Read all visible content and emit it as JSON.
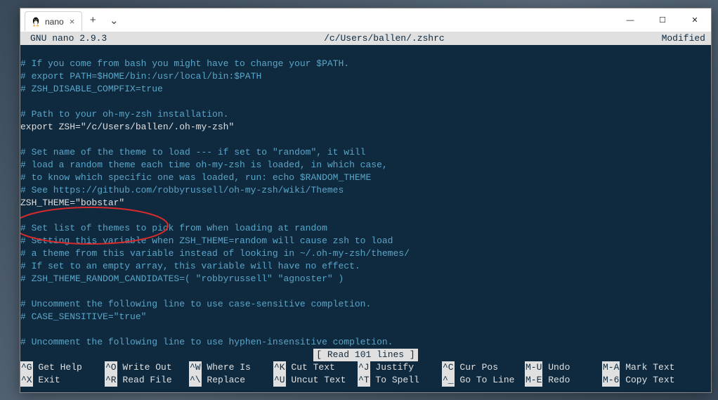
{
  "titlebar": {
    "tab_label": "nano",
    "tab_close": "×",
    "plus": "+",
    "chevron": "⌄"
  },
  "win": {
    "min": "—",
    "max": "☐",
    "close": "✕"
  },
  "nano_header": {
    "left": "GNU nano 2.9.3",
    "center": "/c/Users/ballen/.zshrc",
    "right": "Modified"
  },
  "status": "[ Read 101 lines ]",
  "lines": [
    {
      "cls": "blank",
      "t": ""
    },
    {
      "cls": "comment",
      "t": "# If you come from bash you might have to change your $PATH."
    },
    {
      "cls": "comment",
      "t": "# export PATH=$HOME/bin:/usr/local/bin:$PATH"
    },
    {
      "cls": "comment",
      "t": "# ZSH_DISABLE_COMPFIX=true"
    },
    {
      "cls": "blank",
      "t": ""
    },
    {
      "cls": "comment",
      "t": "# Path to your oh-my-zsh installation."
    },
    {
      "cls": "plain",
      "t": "export ZSH=\"/c/Users/ballen/.oh-my-zsh\""
    },
    {
      "cls": "blank",
      "t": ""
    },
    {
      "cls": "comment",
      "t": "# Set name of the theme to load --- if set to \"random\", it will"
    },
    {
      "cls": "comment",
      "t": "# load a random theme each time oh-my-zsh is loaded, in which case,"
    },
    {
      "cls": "comment",
      "t": "# to know which specific one was loaded, run: echo $RANDOM_THEME"
    },
    {
      "cls": "comment",
      "t": "# See https://github.com/robbyrussell/oh-my-zsh/wiki/Themes"
    },
    {
      "cls": "plain",
      "t": "ZSH_THEME=\"bobstar\""
    },
    {
      "cls": "blank",
      "t": ""
    },
    {
      "cls": "comment",
      "t": "# Set list of themes to pick from when loading at random"
    },
    {
      "cls": "comment",
      "t": "# Setting this variable when ZSH_THEME=random will cause zsh to load"
    },
    {
      "cls": "comment",
      "t": "# a theme from this variable instead of looking in ~/.oh-my-zsh/themes/"
    },
    {
      "cls": "comment",
      "t": "# If set to an empty array, this variable will have no effect."
    },
    {
      "cls": "comment",
      "t": "# ZSH_THEME_RANDOM_CANDIDATES=( \"robbyrussell\" \"agnoster\" )"
    },
    {
      "cls": "blank",
      "t": ""
    },
    {
      "cls": "comment",
      "t": "# Uncomment the following line to use case-sensitive completion."
    },
    {
      "cls": "comment",
      "t": "# CASE_SENSITIVE=\"true\""
    },
    {
      "cls": "blank",
      "t": ""
    },
    {
      "cls": "comment",
      "t": "# Uncomment the following line to use hyphen-insensitive completion."
    }
  ],
  "shortcuts": [
    {
      "k": "^G",
      "l": " Get Help"
    },
    {
      "k": "^O",
      "l": " Write Out"
    },
    {
      "k": "^W",
      "l": " Where Is"
    },
    {
      "k": "^K",
      "l": " Cut Text"
    },
    {
      "k": "^J",
      "l": " Justify"
    },
    {
      "k": "^C",
      "l": " Cur Pos"
    },
    {
      "k": "M-U",
      "l": " Undo"
    },
    {
      "k": "M-A",
      "l": " Mark Text"
    },
    {
      "k": "^X",
      "l": " Exit"
    },
    {
      "k": "^R",
      "l": " Read File"
    },
    {
      "k": "^\\",
      "l": " Replace"
    },
    {
      "k": "^U",
      "l": " Uncut Text"
    },
    {
      "k": "^T",
      "l": " To Spell"
    },
    {
      "k": "^_",
      "l": " Go To Line"
    },
    {
      "k": "M-E",
      "l": " Redo"
    },
    {
      "k": "M-6",
      "l": " Copy Text"
    }
  ],
  "colors": {
    "terminal_bg": "#0f2a3f",
    "comment": "#5aa6c9",
    "plain": "#e0e0e0",
    "header_bg": "#e0e0e0",
    "annotation": "#d82a2a"
  }
}
